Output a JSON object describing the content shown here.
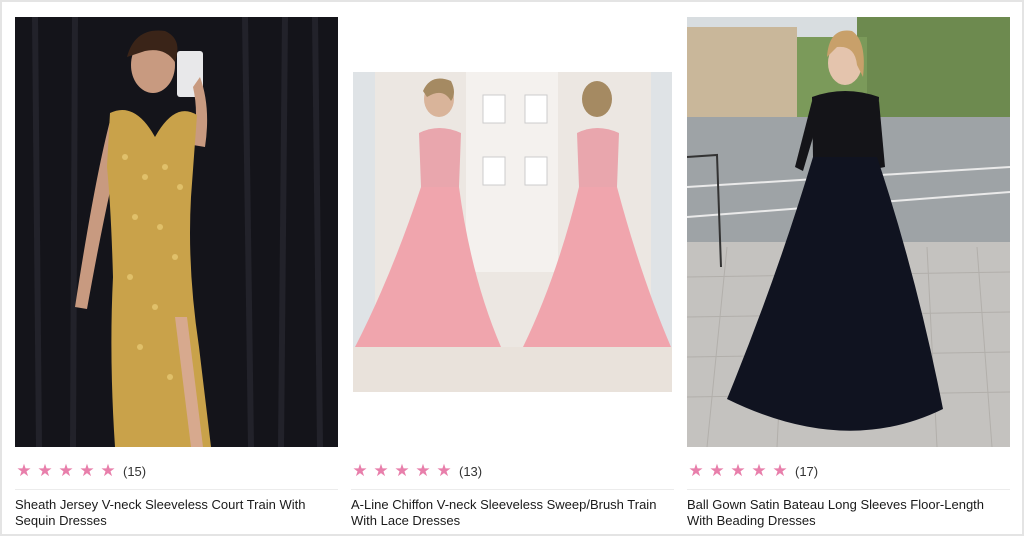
{
  "products": [
    {
      "image_alt": "Gold sequin sheath evening dress",
      "stars": [
        "★",
        "★",
        "★",
        "★",
        "★"
      ],
      "review_count": "(15)",
      "title": "Sheath Jersey V-neck Sleeveless Court Train With Sequin Dresses"
    },
    {
      "image_alt": "Pink chiffon lace A-line dress front and back",
      "stars": [
        "★",
        "★",
        "★",
        "★",
        "★"
      ],
      "review_count": "(13)",
      "title": "A-Line Chiffon V-neck Sleeveless Sweep/Brush Train With Lace Dresses"
    },
    {
      "image_alt": "Black satin ball gown with lace top",
      "stars": [
        "★",
        "★",
        "★",
        "★",
        "★"
      ],
      "review_count": "(17)",
      "title": "Ball Gown Satin Bateau Long Sleeves Floor-Length With Beading Dresses"
    }
  ],
  "colors": {
    "star": "#e87fab",
    "border": "#e4e4e4"
  }
}
